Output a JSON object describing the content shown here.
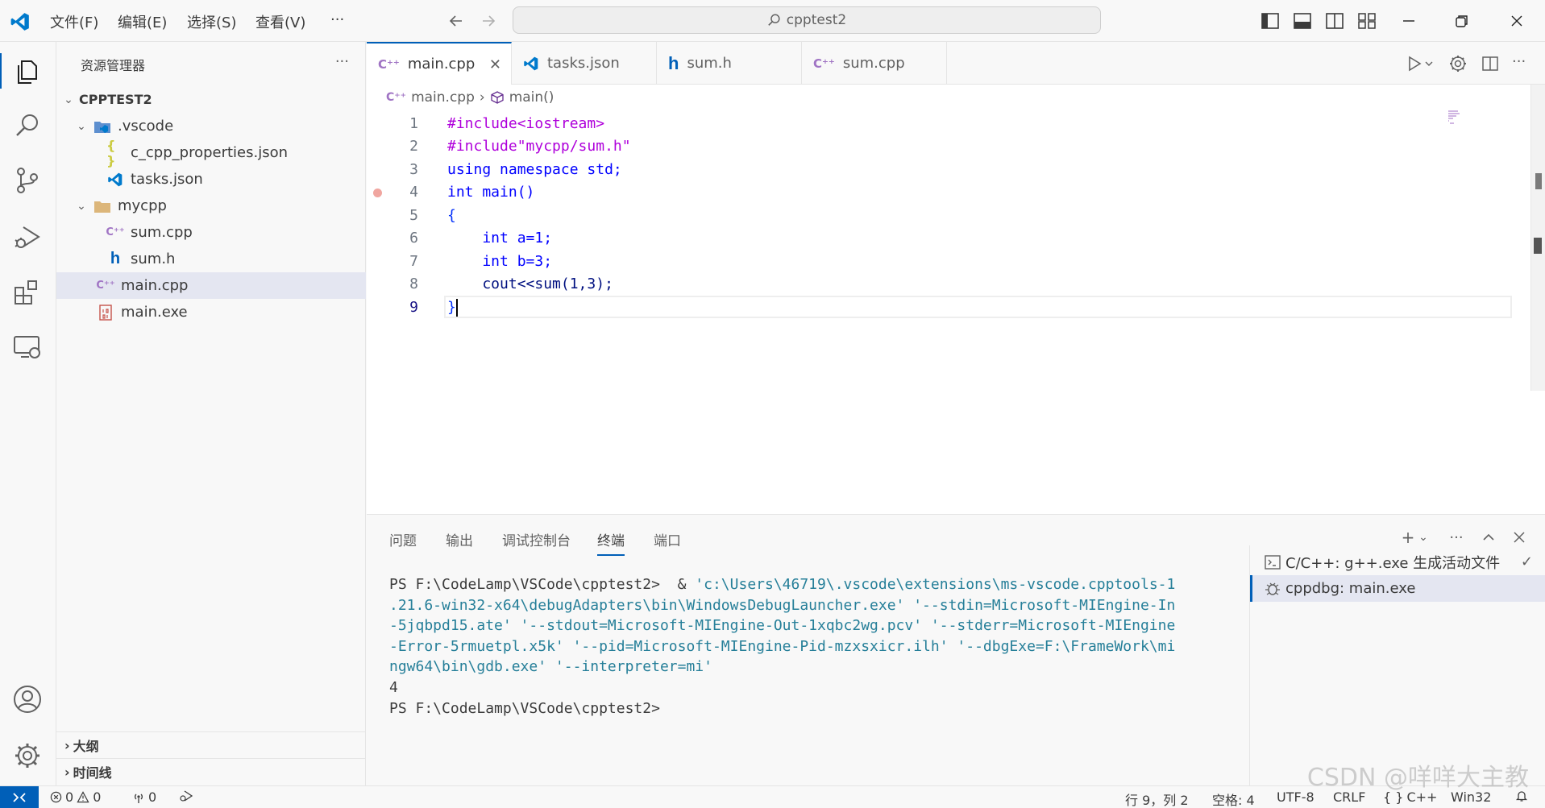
{
  "titlebar": {
    "menus": [
      "文件(F)",
      "编辑(E)",
      "选择(S)",
      "查看(V)",
      "···"
    ],
    "search_text": "cpptest2",
    "brand_color": "#007acc"
  },
  "sidebar": {
    "title": "资源管理器",
    "more": "···",
    "root": "CPPTEST2",
    "tree": [
      {
        "label": ".vscode",
        "icon": "vscode-folder-icon"
      },
      {
        "label": "c_cpp_properties.json",
        "icon": "json-icon"
      },
      {
        "label": "tasks.json",
        "icon": "vscode-icon"
      },
      {
        "label": "mycpp",
        "icon": "folder-icon"
      },
      {
        "label": "sum.cpp",
        "icon": "cpp-icon"
      },
      {
        "label": "sum.h",
        "icon": "header-icon"
      },
      {
        "label": "main.cpp",
        "icon": "cpp-icon"
      },
      {
        "label": "main.exe",
        "icon": "binary-icon"
      }
    ],
    "outline": "大纲",
    "timeline": "时间线"
  },
  "tabs": [
    {
      "label": "main.cpp",
      "active": true
    },
    {
      "label": "tasks.json",
      "active": false
    },
    {
      "label": "sum.h",
      "active": false
    },
    {
      "label": "sum.cpp",
      "active": false
    }
  ],
  "breadcrumb": {
    "file": "main.cpp",
    "symbol": "main()"
  },
  "code": {
    "line_numbers": [
      "1",
      "2",
      "3",
      "4",
      "5",
      "6",
      "7",
      "8",
      "9"
    ],
    "lines": [
      "#include<iostream>",
      "#include\"mycpp/sum.h\"",
      "using namespace std;",
      "int main()",
      "{",
      "    int a=1;",
      "    int b=3;",
      "    cout<<sum(1,3);",
      "}"
    ]
  },
  "panel": {
    "tabs": [
      "问题",
      "输出",
      "调试控制台",
      "终端",
      "端口"
    ],
    "active_tab": "终端",
    "terminal": {
      "prompt1": "PS F:\\CodeLamp\\VSCode\\cpptest2>  & ",
      "cmd": "'c:\\Users\\46719\\.vscode\\extensions\\ms-vscode.cpptools-1\n.21.6-win32-x64\\debugAdapters\\bin\\WindowsDebugLauncher.exe' '--stdin=Microsoft-MIEngine-In\n-5jqbpd15.ate' '--stdout=Microsoft-MIEngine-Out-1xqbc2wg.pcv' '--stderr=Microsoft-MIEngine\n-Error-5rmuetpl.x5k' '--pid=Microsoft-MIEngine-Pid-mzxsxicr.ilh' '--dbgExe=F:\\FrameWork\\mi\nngw64\\bin\\gdb.exe' '--interpreter=mi'",
      "output": "4",
      "prompt2": "PS F:\\CodeLamp\\VSCode\\cpptest2>"
    },
    "terminals": [
      {
        "label": "C/C++: g++.exe 生成活动文件",
        "icon": "terminal-icon",
        "status": "✓"
      },
      {
        "label": "cppdbg: main.exe",
        "icon": "debug-icon"
      }
    ]
  },
  "statusbar": {
    "errors": "0",
    "warnings": "0",
    "ports": "0",
    "position": "行 9，列 2",
    "spaces": "空格: 4",
    "encoding": "UTF-8",
    "eol": "CRLF",
    "language": "C++",
    "platform": "Win32"
  },
  "watermark": "CSDN @咩咩大主教"
}
